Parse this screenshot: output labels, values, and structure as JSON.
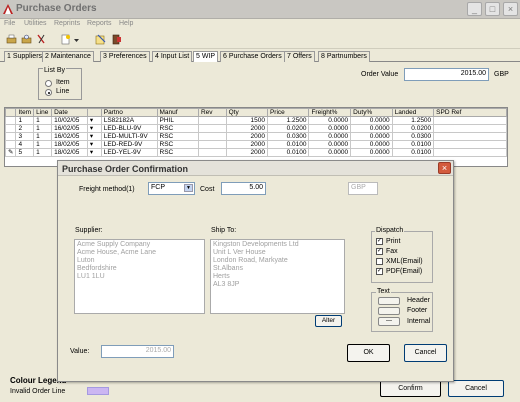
{
  "window": {
    "title": "Purchase Orders",
    "buttons": [
      "_",
      "□",
      "×"
    ]
  },
  "menu": [
    "File",
    "Utilities",
    "Reprints",
    "Reports",
    "Help"
  ],
  "tabs": [
    "1 Suppliers",
    "2 Maintenance",
    "3 Preferences",
    "4 Input List",
    "5 WIP",
    "6 Purchase Orders",
    "7 Offers",
    "8 Partnumbers"
  ],
  "active_tab": "5 WIP",
  "list_by": {
    "legend": "List By",
    "options": [
      "Item",
      "Line"
    ],
    "selected": "Line"
  },
  "order_value": {
    "label": "Order Value",
    "value": "2015.00",
    "currency": "GBP"
  },
  "grid": {
    "headers": [
      "Item",
      "Line",
      "Date",
      "",
      "Partno",
      "Manuf",
      "Rev",
      "Qty",
      "Price",
      "Freight%",
      "Duty%",
      "Landed",
      "SPD Ref"
    ],
    "rows": [
      [
        "1",
        "1",
        "10/02/05",
        "▾",
        "LS82182A",
        "PHIL",
        "",
        "1500",
        "1.2500",
        "0.0000",
        "0.0000",
        "1.2500",
        ""
      ],
      [
        "2",
        "1",
        "16/02/05",
        "▾",
        "LED-BLU-9V",
        "RSC",
        "",
        "2000",
        "0.0200",
        "0.0000",
        "0.0000",
        "0.0200",
        ""
      ],
      [
        "3",
        "1",
        "16/02/05",
        "▾",
        "LED-MULTI-9V",
        "RSC",
        "",
        "2000",
        "0.0300",
        "0.0000",
        "0.0000",
        "0.0300",
        ""
      ],
      [
        "4",
        "1",
        "18/02/05",
        "▾",
        "LED-RED-9V",
        "RSC",
        "",
        "2000",
        "0.0100",
        "0.0000",
        "0.0000",
        "0.0100",
        ""
      ],
      [
        "5",
        "1",
        "18/02/05",
        "▾",
        "LED-YEL-9V",
        "RSC",
        "",
        "2000",
        "0.0100",
        "0.0000",
        "0.0000",
        "0.0100",
        ""
      ]
    ],
    "current_row_marker": "✎"
  },
  "dialog": {
    "title": "Purchase Order Confirmation",
    "freight_label": "Freight method(1)",
    "freight_value": "FCP",
    "cost_label": "Cost",
    "cost_value": "5.00",
    "currency": "GBP",
    "supplier_label": "Supplier:",
    "supplier_lines": [
      "Acme Supply Company",
      "Acme House, Acme Lane",
      "Luton",
      "Bedfordshire",
      "LU1 1LU"
    ],
    "ship_to_label": "Ship To:",
    "ship_to_lines": [
      "Kingston Developments Ltd",
      "Unit L Ver House",
      "London Road, Markyate",
      "St.Albans",
      "Herts",
      "AL3 8JP"
    ],
    "alter_label": "Alter",
    "dispatch": {
      "legend": "Dispatch",
      "options": [
        {
          "label": "Print",
          "checked": true
        },
        {
          "label": "Fax",
          "checked": true
        },
        {
          "label": "XML(Email)",
          "checked": false
        },
        {
          "label": "PDF(Email)",
          "checked": true
        }
      ]
    },
    "text_group": {
      "legend": "Text",
      "buttons": [
        "Header",
        "Footer",
        "Internal"
      ]
    },
    "value_label": "Value:",
    "value": "2015.00",
    "ok_label": "OK",
    "cancel_label": "Cancel"
  },
  "colour_legend": {
    "title": "Colour Legend",
    "item": "Invalid Order Line",
    "color": "#cbb6f2"
  },
  "footer": {
    "confirm_label": "Confirm",
    "cancel_label": "Cancel"
  }
}
